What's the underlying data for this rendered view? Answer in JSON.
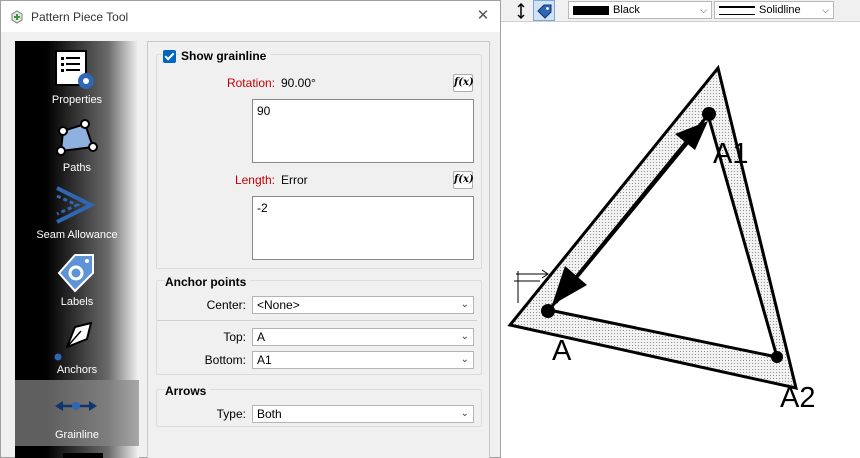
{
  "toolbar": {
    "color_label": "Black",
    "line_label": "Solidline"
  },
  "dialog": {
    "title": "Pattern Piece Tool",
    "nav": [
      {
        "label": "Properties"
      },
      {
        "label": "Paths"
      },
      {
        "label": "Seam Allowance"
      },
      {
        "label": "Labels"
      },
      {
        "label": "Anchors"
      },
      {
        "label": "Grainline"
      }
    ],
    "grainline": {
      "show_label": "Show grainline",
      "show_checked": true,
      "rotation_label": "Rotation:",
      "rotation_value": "90.00°",
      "rotation_formula": "90",
      "length_label": "Length:",
      "length_value": "Error",
      "length_formula": "-2",
      "fx_label": "f(x)"
    },
    "anchor_points": {
      "title": "Anchor points",
      "center_label": "Center:",
      "center_value": "<None>",
      "top_label": "Top:",
      "top_value": "A",
      "bottom_label": "Bottom:",
      "bottom_value": "A1"
    },
    "arrows": {
      "title": "Arrows",
      "type_label": "Type:",
      "type_value": "Both"
    }
  },
  "canvas": {
    "points": [
      "A",
      "A1",
      "A2"
    ]
  }
}
